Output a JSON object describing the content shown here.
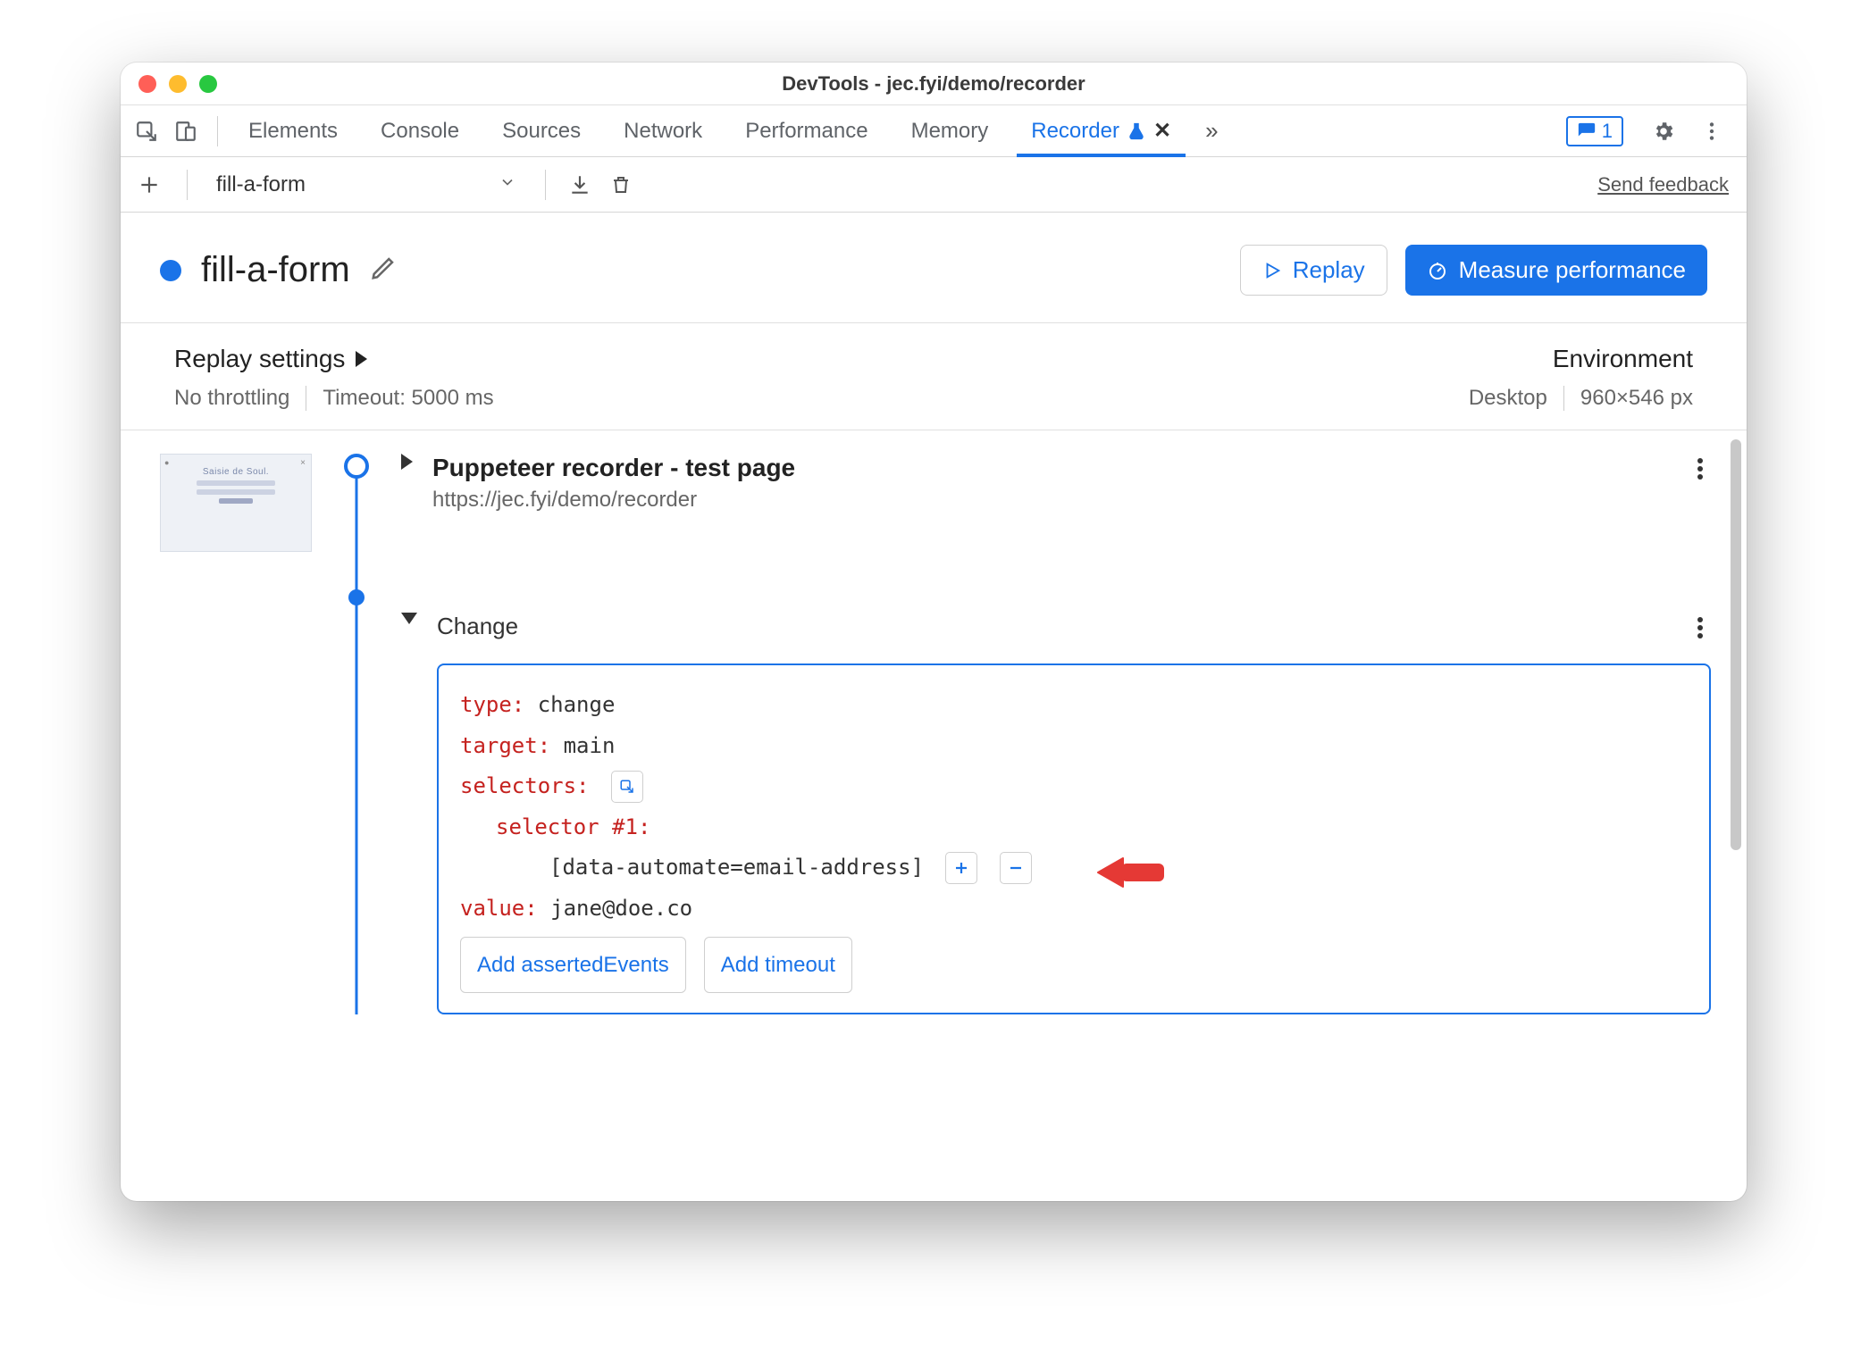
{
  "window": {
    "title": "DevTools - jec.fyi/demo/recorder"
  },
  "tabs": {
    "items": [
      "Elements",
      "Console",
      "Sources",
      "Network",
      "Performance",
      "Memory",
      "Recorder"
    ],
    "active": "Recorder",
    "issues_count": "1"
  },
  "toolbar": {
    "recording_name": "fill-a-form",
    "send_feedback": "Send feedback"
  },
  "header": {
    "title": "fill-a-form",
    "replay_label": "Replay",
    "measure_label": "Measure performance"
  },
  "settings": {
    "replay_heading": "Replay settings",
    "throttling": "No throttling",
    "timeout": "Timeout: 5000 ms",
    "env_heading": "Environment",
    "device": "Desktop",
    "viewport": "960×546 px"
  },
  "steps": {
    "start": {
      "title": "Puppeteer recorder - test page",
      "url": "https://jec.fyi/demo/recorder"
    },
    "change": {
      "label": "Change",
      "type_key": "type",
      "type_val": "change",
      "target_key": "target",
      "target_val": "main",
      "selectors_key": "selectors",
      "selector_n_key": "selector #1",
      "selector_value": "[data-automate=email-address]",
      "value_key": "value",
      "value_val": "jane@doe.co",
      "add_asserted": "Add assertedEvents",
      "add_timeout": "Add timeout"
    }
  }
}
